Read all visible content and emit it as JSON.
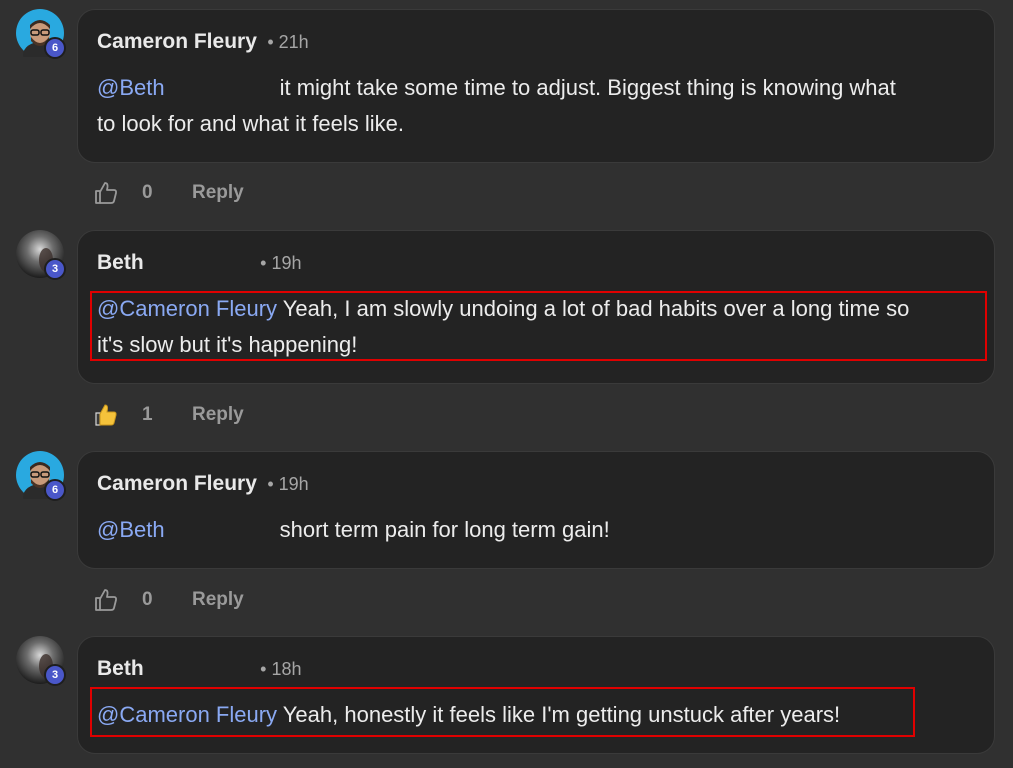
{
  "comments": [
    {
      "author": "Cameron Fleury",
      "level": "6",
      "time": "21h",
      "mention": "@Beth",
      "text_line1": "it might take some time to adjust. Biggest thing is knowing what",
      "text_line2": "to look for and what it feels like.",
      "likes": "0",
      "liked": false,
      "reply_label": "Reply"
    },
    {
      "author": "Beth",
      "level": "3",
      "time": "19h",
      "mention": "@Cameron Fleury",
      "text_line1": "Yeah, I am slowly undoing a lot of bad habits over a long time so",
      "text_line2": "it's slow but it's happening!",
      "likes": "1",
      "liked": true,
      "reply_label": "Reply"
    },
    {
      "author": "Cameron Fleury",
      "level": "6",
      "time": "19h",
      "mention": "@Beth",
      "text_line1": "short term pain for long term gain!",
      "likes": "0",
      "liked": false,
      "reply_label": "Reply"
    },
    {
      "author": "Beth",
      "level": "3",
      "time": "18h",
      "mention": "@Cameron Fleury",
      "text_line1": "Yeah, honestly it feels like I'm getting unstuck after years!",
      "liked": false
    }
  ],
  "colors": {
    "background": "#303030",
    "bubble": "#232323",
    "mention": "#8aa9f3",
    "level_badge": "#4a57c9",
    "highlight": "#e00000",
    "liked_thumb": "#f5c33b"
  },
  "icons": {
    "like": "thumbs-up-icon",
    "liked": "thumbs-up-filled-icon"
  }
}
